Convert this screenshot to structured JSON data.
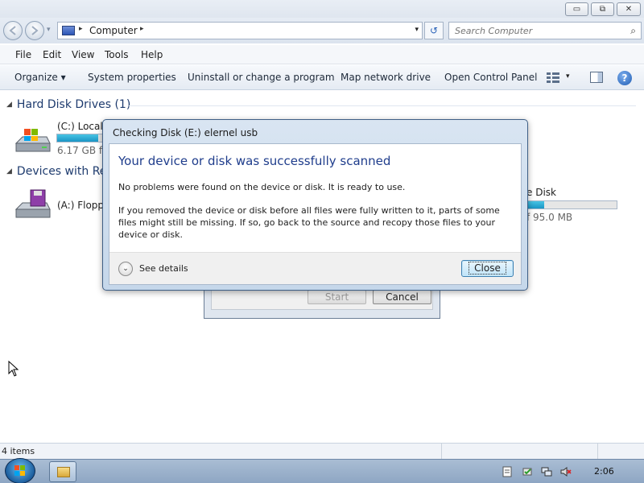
{
  "window_controls": {
    "minimize_glyph": "▭",
    "maximize_glyph": "⧉",
    "close_glyph": "✕"
  },
  "address": {
    "crumb": "Computer",
    "separator": "▸",
    "dropdown_glyph": "▾",
    "refresh_glyph": "↺",
    "search_placeholder": "Search Computer"
  },
  "menu": {
    "file": "File",
    "edit": "Edit",
    "view": "View",
    "tools": "Tools",
    "help": "Help"
  },
  "command_bar": {
    "organize": "Organize ▾",
    "system_properties": "System properties",
    "uninstall": "Uninstall or change a program",
    "map_network_drive": "Map network drive",
    "open_control_panel": "Open Control Panel",
    "help_glyph": "?",
    "view_dropdown_glyph": "▾"
  },
  "content": {
    "groups": [
      {
        "title": "Hard Disk Drives (1)",
        "collapse_glyph": "◢"
      },
      {
        "title": "Devices with Re",
        "collapse_glyph": "◢"
      }
    ],
    "items": {
      "local_disk_label": "(C:) Local D",
      "local_disk_free": "6.17 GB fre",
      "local_disk_fill": 0.85,
      "floppy_label": "(A:) Floppy",
      "removable_label": "e Disk",
      "removable_size": "f 95.0 MB",
      "removable_fill": 0.2
    }
  },
  "background_window": {
    "start_label": "Start",
    "cancel_label": "Cancel"
  },
  "dialog": {
    "title": "Checking Disk (E:) elernel usb",
    "heading": "Your device or disk was successfully scanned",
    "message1": "No problems were found on the device or disk. It is ready to use.",
    "message2": "If you removed the device or disk before all files were fully written to it, parts of some files might still be missing. If so, go back to the source and recopy those files to your device or disk.",
    "details_label": "See details",
    "details_glyph": "⌄",
    "close_label": "Close"
  },
  "status_bar": {
    "item_count": "4 items"
  },
  "taskbar": {
    "clock": "2:06"
  },
  "colors": {
    "accent": "#1f3d8c",
    "capacity_fill": "#26a6d1",
    "taskbar": "#9bb2cc"
  }
}
